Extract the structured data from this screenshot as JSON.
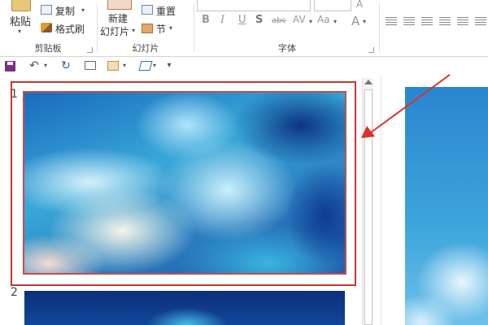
{
  "ribbon": {
    "clipboard": {
      "paste_label": "粘贴",
      "copy_label": "复制",
      "format_painter_label": "格式刷",
      "group_label": "剪贴板"
    },
    "slides": {
      "new_slide_line1": "新建",
      "new_slide_line2": "幻灯片",
      "reset_label": "重置",
      "section_label": "节",
      "group_label": "幻灯片"
    },
    "font": {
      "bold": "B",
      "italic": "I",
      "underline": "U",
      "shadow": "S",
      "strike": "abc",
      "spacing": "AV",
      "change_case": "Aa",
      "font_color": "A",
      "group_label": "字体"
    }
  },
  "qat": {
    "undo": "↶",
    "repeat": "↻",
    "more": "▾"
  },
  "slide_pane": {
    "slides": [
      {
        "number": "1"
      },
      {
        "number": "2"
      }
    ]
  },
  "colors": {
    "selection_frame": "#c5372f",
    "arrow": "#d9302c",
    "save_icon": "#7b2d86"
  }
}
